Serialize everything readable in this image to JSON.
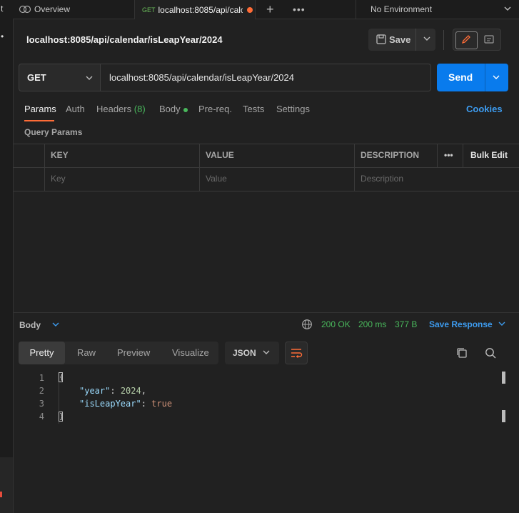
{
  "tabbar": {
    "overview_label": "Overview",
    "active_tab": {
      "method": "GET",
      "label": "localhost:8085/api/calc"
    },
    "environment": "No Environment"
  },
  "request": {
    "title": "localhost:8085/api/calendar/isLeapYear/2024",
    "save_label": "Save",
    "method": "GET",
    "url": "localhost:8085/api/calendar/isLeapYear/2024",
    "send_label": "Send"
  },
  "request_tabs": {
    "params": "Params",
    "auth": "Auth",
    "headers": "Headers",
    "headers_count": "(8)",
    "body": "Body",
    "prereq": "Pre-req.",
    "tests": "Tests",
    "settings": "Settings",
    "cookies": "Cookies"
  },
  "query_params": {
    "title": "Query Params",
    "columns": {
      "key": "KEY",
      "value": "VALUE",
      "description": "DESCRIPTION",
      "more": "•••",
      "bulk_edit": "Bulk Edit"
    },
    "placeholders": {
      "key": "Key",
      "value": "Value",
      "description": "Description"
    }
  },
  "response": {
    "body_label": "Body",
    "status": "200 OK",
    "time": "200 ms",
    "size": "377 B",
    "save_response": "Save Response",
    "view_tabs": {
      "pretty": "Pretty",
      "raw": "Raw",
      "preview": "Preview",
      "visualize": "Visualize"
    },
    "format": "JSON",
    "lines": [
      "1",
      "2",
      "3",
      "4"
    ],
    "json": {
      "year_key": "\"year\"",
      "year_value": "2024",
      "leap_key": "\"isLeapYear\"",
      "leap_value": "true"
    }
  },
  "left_strip": {
    "top_glyph": "t",
    "dot_glyph": "•"
  }
}
